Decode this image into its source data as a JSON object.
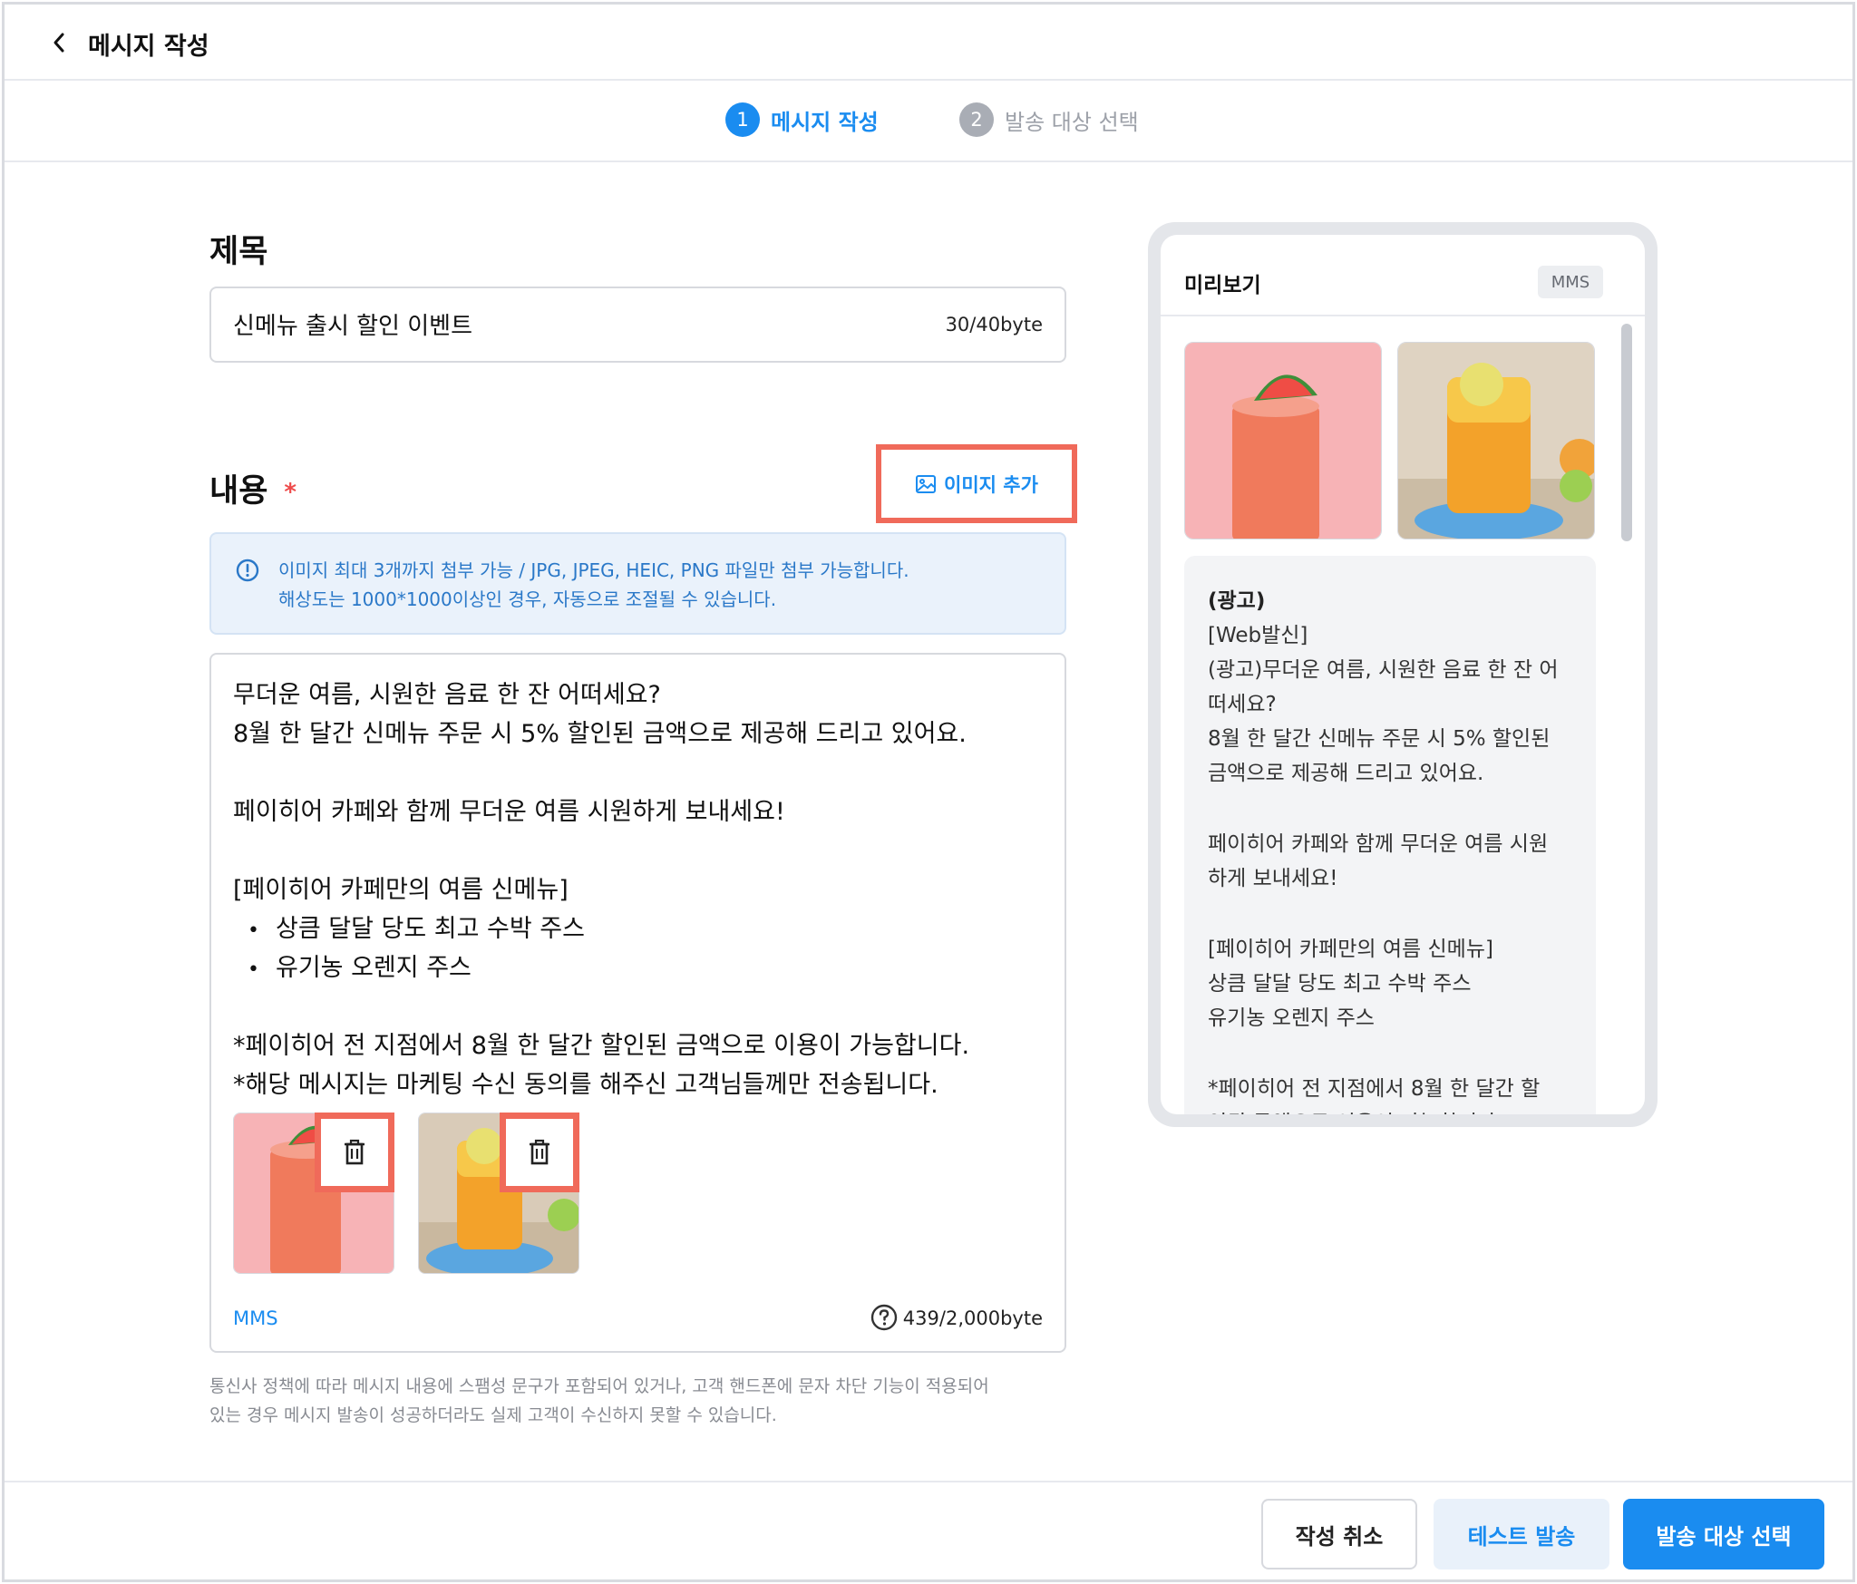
{
  "header": {
    "title": "메시지 작성"
  },
  "stepper": {
    "steps": [
      {
        "num": "1",
        "label": "메시지 작성",
        "active": true
      },
      {
        "num": "2",
        "label": "발송 대상 선택",
        "active": false
      }
    ]
  },
  "subject": {
    "section_title": "제목",
    "value": "신메뉴 출시 할인 이벤트",
    "byte_count": "30/40byte"
  },
  "content": {
    "section_title": "내용",
    "required_mark": "*",
    "add_image_label": "이미지 추가",
    "notice_lines": [
      "이미지 최대 3개까지 첨부 가능 / JPG, JPEG, HEIC, PNG 파일만 첨부 가능합니다.",
      "해상도는 1000*1000이상인 경우, 자동으로 조절될 수 있습니다."
    ],
    "body_lines": [
      "무더운 여름, 시원한 음료 한 잔 어떠세요?",
      "8월 한 달간 신메뉴 주문 시 5% 할인된 금액으로 제공해 드리고 있어요.",
      "페이히어 카페와 함께 무더운 여름 시원하게 보내세요!",
      "[페이히어 카페만의 여름 신메뉴]",
      "상큼 달달 당도 최고 수박 주스",
      "유기농 오렌지 주스",
      "*페이히어 전 지점에서 8월 한 달간 할인된 금액으로 이용이 가능합니다.",
      "*해당 메시지는 마케팅 수신 동의를 해주신 고객님들께만 전송됩니다."
    ],
    "message_type": "MMS",
    "byte_count": "439/2,000byte"
  },
  "disclaimer_lines": [
    "통신사 정책에 따라 메시지 내용에 스팸성 문구가 포함되어 있거나, 고객 핸드폰에 문자 차단 기능이 적용되어",
    "있는 경우 메시지 발송이 성공하더라도 실제 고객이 수신하지 못할 수 있습니다."
  ],
  "preview": {
    "title": "미리보기",
    "badge": "MMS",
    "lines": [
      "(광고)",
      "[Web발신]",
      "(광고)무더운 여름, 시원한 음료 한 잔 어",
      "떠세요?",
      "8월 한 달간 신메뉴 주문 시 5% 할인된",
      "금액으로 제공해 드리고 있어요.",
      "페이히어 카페와 함께 무더운 여름 시원",
      "하게 보내세요!",
      "[페이히어 카페만의 여름 신메뉴]",
      "상큼 달달 당도 최고 수박 주스",
      "유기농 오렌지 주스",
      "*페이히어 전 지점에서 8월 한 달간 할",
      "인된 금액으로 이용이 가능합니다."
    ]
  },
  "footer": {
    "cancel_label": "작성 취소",
    "test_label": "테스트 발송",
    "next_label": "발송 대상 선택"
  },
  "colors": {
    "primary": "#1a8cf0",
    "highlight": "#f06a5a",
    "notice_bg": "#eaf2fb"
  },
  "icons": [
    "chevron-left-icon",
    "image-icon",
    "info-icon",
    "trash-icon",
    "help-circle-icon"
  ]
}
